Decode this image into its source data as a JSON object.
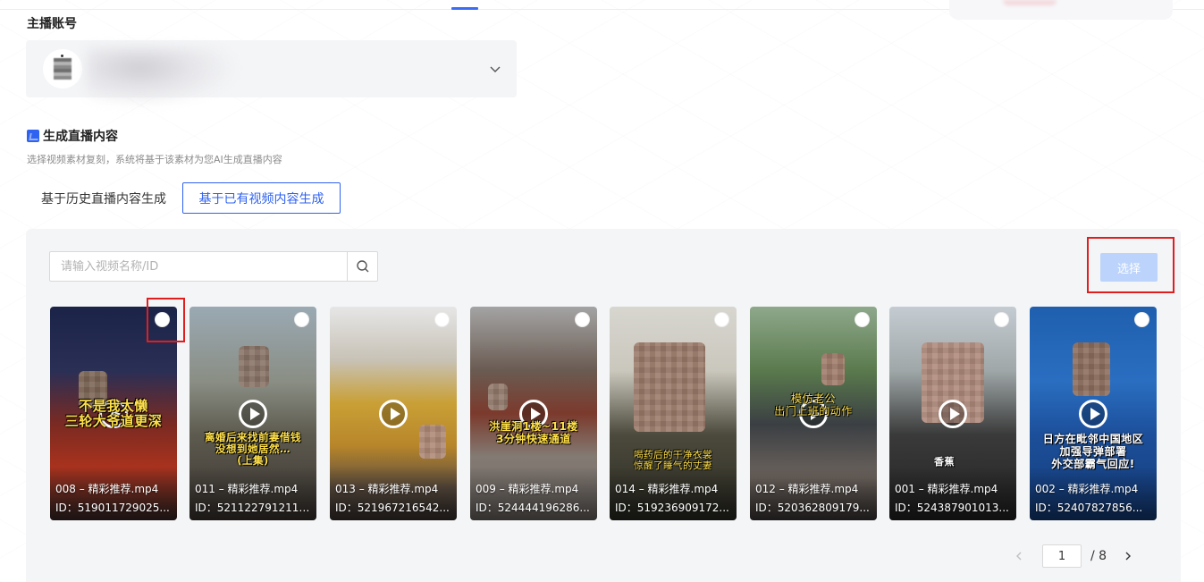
{
  "section": {
    "anchor_account_label": "主播账号"
  },
  "generate": {
    "title": "生成直播内容",
    "description": "选择视频素材复刻，系统将基于该素材为您AI生成直播内容",
    "tabs": [
      {
        "label": "基于历史直播内容生成",
        "active": false
      },
      {
        "label": "基于已有视频内容生成",
        "active": true
      }
    ]
  },
  "search": {
    "placeholder": "请输入视频名称/ID"
  },
  "select_button": {
    "label": "选择"
  },
  "videos": [
    {
      "name": "008 – 精彩推荐.mp4",
      "id": "ID：519011729025...",
      "caption": [
        "不是我太懒",
        "三轮大爷道更深"
      ]
    },
    {
      "name": "011 – 精彩推荐.mp4",
      "id": "ID：5211227912110...",
      "caption": [
        "离婚后来找前妻借钱",
        "没想到她居然…",
        "(上集)"
      ]
    },
    {
      "name": "013 – 精彩推荐.mp4",
      "id": "ID：521967216542...",
      "caption": []
    },
    {
      "name": "009 – 精彩推荐.mp4",
      "id": "ID：524444196286...",
      "caption": [
        "洪崖洞1楼~11楼",
        "3分钟快速通道"
      ]
    },
    {
      "name": "014 – 精彩推荐.mp4",
      "id": "ID：519236909172...",
      "caption": [
        "喝药后的干净衣裳",
        "惊醒了睡气的丈妻"
      ]
    },
    {
      "name": "012 – 精彩推荐.mp4",
      "id": "ID：520362809179...",
      "caption": [
        "模仿老公",
        "出门上班的动作"
      ]
    },
    {
      "name": "001 – 精彩推荐.mp4",
      "id": "ID：524387901013...",
      "caption": [
        "香蕉"
      ]
    },
    {
      "name": "002 – 精彩推荐.mp4",
      "id": "ID：52407827856...",
      "caption": [
        "日方在毗邻中国地区",
        "加强导弹部署",
        "外交部霸气回应!"
      ]
    }
  ],
  "pagination": {
    "current": "1",
    "total": "/ 8"
  },
  "colors": {
    "accent": "#2f62f0",
    "select_disabled": "#bcd3fb",
    "highlight": "#e01e1e"
  }
}
